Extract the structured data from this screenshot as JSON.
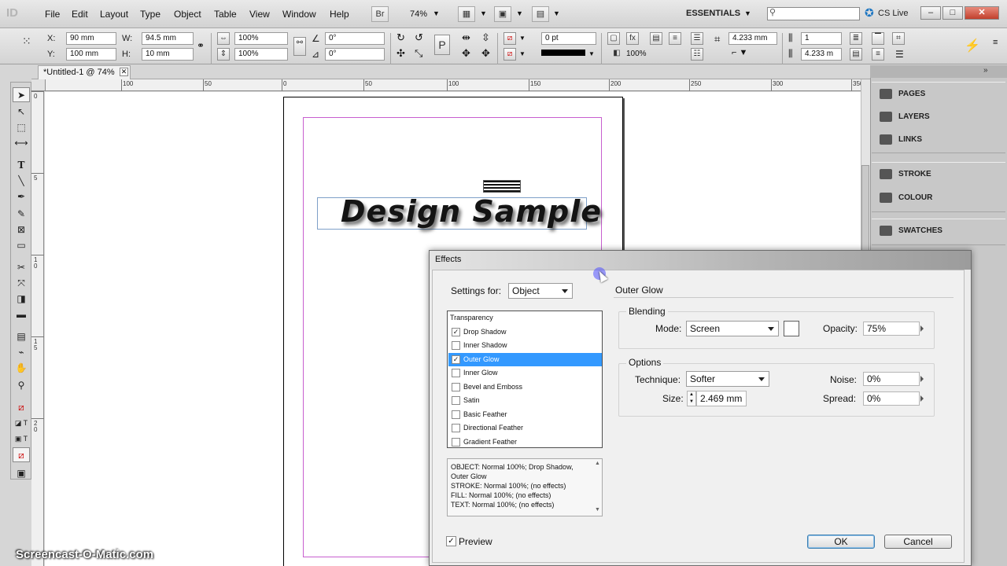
{
  "app": {
    "logo": "ID",
    "doc_tab": "*Untitled-1 @ 74%",
    "zoom": "74%",
    "bridge": "Br",
    "workspace": "ESSENTIALS",
    "cslive": "CS Live"
  },
  "menu": [
    "File",
    "Edit",
    "Layout",
    "Type",
    "Object",
    "Table",
    "View",
    "Window",
    "Help"
  ],
  "window_controls": {
    "minimize": "–",
    "maximize": "□",
    "close": "✕"
  },
  "control": {
    "x_label": "X:",
    "x_value": "90 mm",
    "y_label": "Y:",
    "y_value": "100 mm",
    "w_label": "W:",
    "w_value": "94.5 mm",
    "h_label": "H:",
    "h_value": "10 mm",
    "scale_x": "100%",
    "scale_y": "100%",
    "rotate": "0°",
    "shear": "0°",
    "stroke_weight": "0 pt",
    "opacity": "100%",
    "offset_a": "4.233 mm",
    "offset_b": "4.233 m",
    "columns": "1"
  },
  "ruler_h": [
    "100",
    "50",
    "0",
    "50",
    "100",
    "150",
    "200",
    "250",
    "300",
    "350"
  ],
  "ruler_v": [
    "0",
    "5",
    "1 0",
    "1 5",
    "2 0"
  ],
  "document": {
    "headline": "Design Sample"
  },
  "panels": {
    "group1": [
      {
        "label": "PAGES",
        "icon": "pages-icon"
      },
      {
        "label": "LAYERS",
        "icon": "layers-icon"
      },
      {
        "label": "LINKS",
        "icon": "links-icon"
      }
    ],
    "group2": [
      {
        "label": "STROKE",
        "icon": "stroke-icon"
      },
      {
        "label": "COLOUR",
        "icon": "colour-icon"
      }
    ],
    "group3": [
      {
        "label": "SWATCHES",
        "icon": "swatches-icon"
      }
    ]
  },
  "dialog": {
    "title": "Effects",
    "settings_for_label": "Settings for:",
    "settings_for_value": "Object",
    "section_title": "Outer Glow",
    "effects": [
      {
        "label": "Transparency",
        "checkbox": false,
        "checked": false,
        "selected": false
      },
      {
        "label": "Drop Shadow",
        "checkbox": true,
        "checked": true,
        "selected": false
      },
      {
        "label": "Inner Shadow",
        "checkbox": true,
        "checked": false,
        "selected": false
      },
      {
        "label": "Outer Glow",
        "checkbox": true,
        "checked": true,
        "selected": true
      },
      {
        "label": "Inner Glow",
        "checkbox": true,
        "checked": false,
        "selected": false
      },
      {
        "label": "Bevel and Emboss",
        "checkbox": true,
        "checked": false,
        "selected": false
      },
      {
        "label": "Satin",
        "checkbox": true,
        "checked": false,
        "selected": false
      },
      {
        "label": "Basic Feather",
        "checkbox": true,
        "checked": false,
        "selected": false
      },
      {
        "label": "Directional Feather",
        "checkbox": true,
        "checked": false,
        "selected": false
      },
      {
        "label": "Gradient Feather",
        "checkbox": true,
        "checked": false,
        "selected": false
      }
    ],
    "summary": [
      "OBJECT: Normal 100%; Drop Shadow,",
      "Outer Glow",
      "STROKE: Normal 100%; (no effects)",
      "FILL: Normal 100%; (no effects)",
      "TEXT: Normal 100%; (no effects)"
    ],
    "blending": {
      "title": "Blending",
      "mode_label": "Mode:",
      "mode_value": "Screen",
      "opacity_label": "Opacity:",
      "opacity_value": "75%"
    },
    "options": {
      "title": "Options",
      "technique_label": "Technique:",
      "technique_value": "Softer",
      "size_label": "Size:",
      "size_value": "2.469 mm",
      "noise_label": "Noise:",
      "noise_value": "0%",
      "spread_label": "Spread:",
      "spread_value": "0%"
    },
    "preview_label": "Preview",
    "ok_label": "OK",
    "cancel_label": "Cancel"
  },
  "colors": {
    "selection": "#3399ff",
    "margin_guide": "#c75fcf",
    "frame": "#7ea0c8"
  },
  "watermark": "Screencast-O-Matic.com"
}
